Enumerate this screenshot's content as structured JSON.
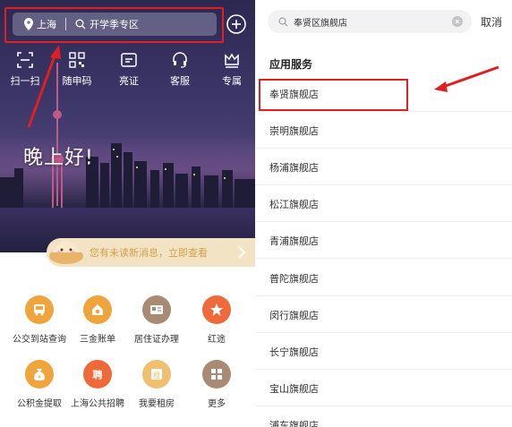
{
  "left": {
    "search": {
      "city": "上海",
      "query": "开学季专区"
    },
    "quick_actions": [
      {
        "label": "扫一扫",
        "icon": "scan-icon"
      },
      {
        "label": "随申码",
        "icon": "qrcode-icon"
      },
      {
        "label": "亮证",
        "icon": "id-card-icon"
      },
      {
        "label": "客服",
        "icon": "headset-icon"
      },
      {
        "label": "专属",
        "icon": "crown-icon"
      }
    ],
    "greeting": "晚上好!",
    "message": "您有未读新消息，立即查看",
    "services": [
      {
        "label": "公交到站查询",
        "icon": "bus-icon",
        "color": "#f0a43c"
      },
      {
        "label": "三金账单",
        "icon": "house-coin-icon",
        "color": "#f0a43c"
      },
      {
        "label": "居住证办理",
        "icon": "card-icon",
        "color": "#a98a73"
      },
      {
        "label": "红途",
        "icon": "star-icon",
        "color": "#ee6a3a"
      },
      {
        "label": "公积金提取",
        "icon": "money-bag-icon",
        "color": "#f0a43c"
      },
      {
        "label": "上海公共招聘",
        "icon": "recruit-icon",
        "color": "#ee6a3a"
      },
      {
        "label": "我要租房",
        "icon": "rent-icon",
        "color": "#f0c070"
      },
      {
        "label": "更多",
        "icon": "more-grid-icon",
        "color": "#a98a73"
      }
    ]
  },
  "right": {
    "search_value": "奉贤区旗舰店",
    "cancel": "取消",
    "section_title": "应用服务",
    "results": [
      "奉贤旗舰店",
      "崇明旗舰店",
      "杨浦旗舰店",
      "松江旗舰店",
      "青浦旗舰店",
      "普陀旗舰店",
      "闵行旗舰店",
      "长宁旗舰店",
      "宝山旗舰店",
      "浦东旗舰店"
    ]
  },
  "colors": {
    "annotation_red": "#e02020",
    "accent_orange": "#f0a43c"
  }
}
